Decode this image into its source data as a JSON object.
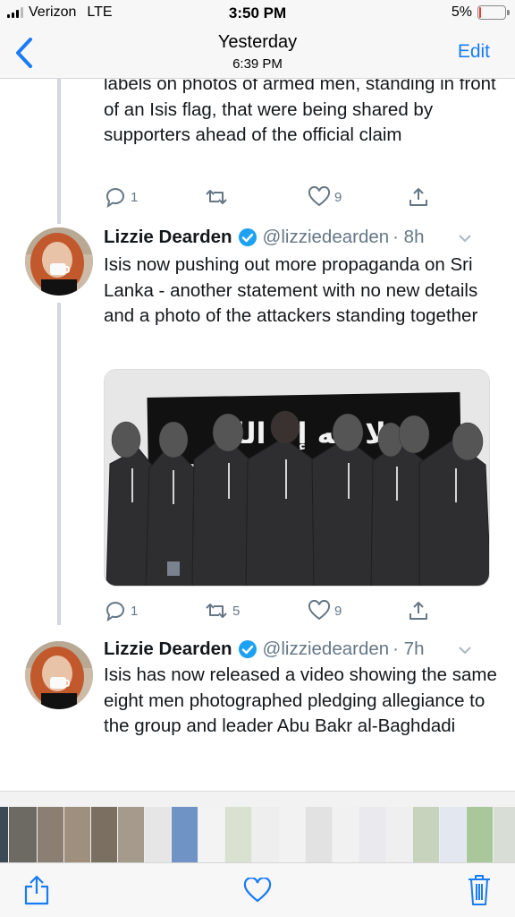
{
  "status": {
    "carrier": "Verizon",
    "network": "LTE",
    "time": "3:50 PM",
    "battery": "5%",
    "battery_level": 0.05,
    "battery_color": "#e53935"
  },
  "nav": {
    "back_icon": "chevron-left-icon",
    "title": "Yesterday",
    "subtitle": "6:39 PM",
    "edit_label": "Edit",
    "accent": "#1a7cf5"
  },
  "tweets": [
    {
      "text": "labels on photos of armed men, standing in front of an Isis flag, that were being shared by supporters ahead of the official claim",
      "replies": "1",
      "retweets": "",
      "likes": "9"
    },
    {
      "name": "Lizzie Dearden",
      "handle": "@lizziedearden",
      "time": "· 8h",
      "text": "Isis now pushing out more propaganda on Sri Lanka - another statement with no new details and a photo of the attackers standing together",
      "media_text": "لا إله إلا الله",
      "replies": "1",
      "retweets": "5",
      "likes": "9"
    },
    {
      "name": "Lizzie Dearden",
      "handle": "@lizziedearden",
      "time": "· 7h",
      "text": "Isis has now released a video showing the same eight men photographed pledging allegiance to the group and leader Abu Bakr al-Baghdadi"
    }
  ],
  "toolbar": {
    "share_icon": "share-icon",
    "like_icon": "heart-icon",
    "delete_icon": "trash-icon",
    "accent": "#1a7cf5"
  }
}
